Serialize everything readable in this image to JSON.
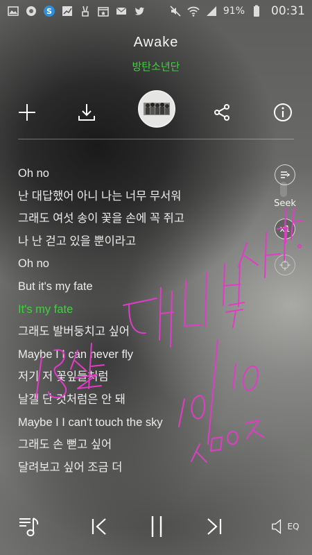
{
  "status_bar": {
    "battery": "91%",
    "time": "00:31",
    "icons": [
      "image-icon",
      "record-icon",
      "skype-icon",
      "chart-icon",
      "victory-icon",
      "schedule-icon",
      "gmail-icon",
      "twitter-icon",
      "mute-icon",
      "wifi-icon",
      "signal-icon",
      "battery-icon"
    ]
  },
  "song": {
    "title": "Awake",
    "artist": "방탄소년단"
  },
  "actions": [
    "add-icon",
    "download-icon",
    "album-art",
    "share-icon",
    "info-icon"
  ],
  "lyrics": [
    {
      "text": "Oh no",
      "current": false
    },
    {
      "text": "난 대답했어 아니 나는 너무 무서워",
      "current": false
    },
    {
      "text": "그래도 여섯 송이 꽃을 손에 꼭 쥐고",
      "current": false
    },
    {
      "text": "나 난 걷고 있을 뿐이라고",
      "current": false
    },
    {
      "text": "Oh no",
      "current": false
    },
    {
      "text": "But it's my fate",
      "current": false
    },
    {
      "text": "It's my fate",
      "current": true
    },
    {
      "text": "그래도 발버둥치고 싶어",
      "current": false
    },
    {
      "text": "Maybe I I can never fly",
      "current": false
    },
    {
      "text": "저기 저 꽃잎들처럼",
      "current": false
    },
    {
      "text": "날갤 단 것처럼은 안 돼",
      "current": false
    },
    {
      "text": "Maybe I I can't touch the sky",
      "current": false
    },
    {
      "text": "그래도 손 뻗고 싶어",
      "current": false
    },
    {
      "text": "달려보고 싶어 조금 더",
      "current": false
    }
  ],
  "side": {
    "seek_label": "Seek",
    "speed_label": "x1"
  },
  "controls": {
    "eq_label": "EQ"
  },
  "handwriting": {
    "lines": [
      "18살 대니박 사람",
      "10/10",
      "ㅅㅁㅇㅈ"
    ],
    "color": "#e23cc6"
  },
  "colors": {
    "accent": "#3fd13f",
    "text": "#ececec"
  }
}
